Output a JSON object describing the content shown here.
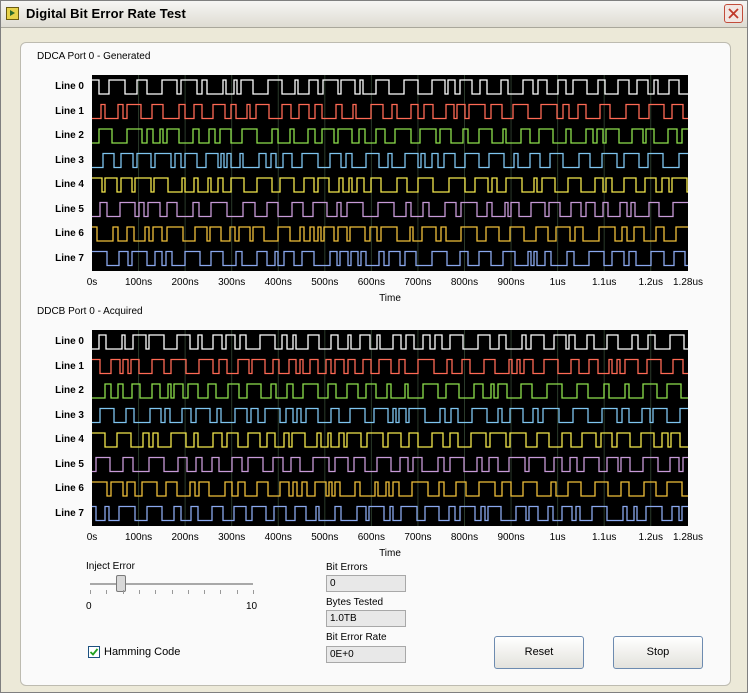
{
  "window": {
    "title": "Digital Bit Error Rate Test"
  },
  "graphs": [
    {
      "title": "DDCA Port 0 - Generated",
      "x_axis_title": "Time"
    },
    {
      "title": "DDCB Port 0 - Acquired",
      "x_axis_title": "Time"
    }
  ],
  "line_labels": [
    "Line 0",
    "Line 1",
    "Line 2",
    "Line 3",
    "Line 4",
    "Line 5",
    "Line 6",
    "Line 7"
  ],
  "line_colors": [
    "#ffffff",
    "#ff6a55",
    "#8ee04c",
    "#7fc5f0",
    "#f4e84c",
    "#c89ad8",
    "#f0c03a",
    "#8aa8ee"
  ],
  "x_ticks": [
    "0s",
    "100ns",
    "200ns",
    "300ns",
    "400ns",
    "500ns",
    "600ns",
    "700ns",
    "800ns",
    "900ns",
    "1us",
    "1.1us",
    "1.2us",
    "1.28us"
  ],
  "inject_error": {
    "label": "Inject Error",
    "min": "0",
    "max": "10",
    "value": 1
  },
  "bit_errors": {
    "label": "Bit Errors",
    "value": "0"
  },
  "bytes_tested": {
    "label": "Bytes Tested",
    "value": "1.0TB"
  },
  "bit_error_rate": {
    "label": "Bit Error Rate",
    "value": "0E+0"
  },
  "hamming": {
    "label": "Hamming Code",
    "checked": true
  },
  "buttons": {
    "reset": "Reset",
    "stop": "Stop"
  }
}
